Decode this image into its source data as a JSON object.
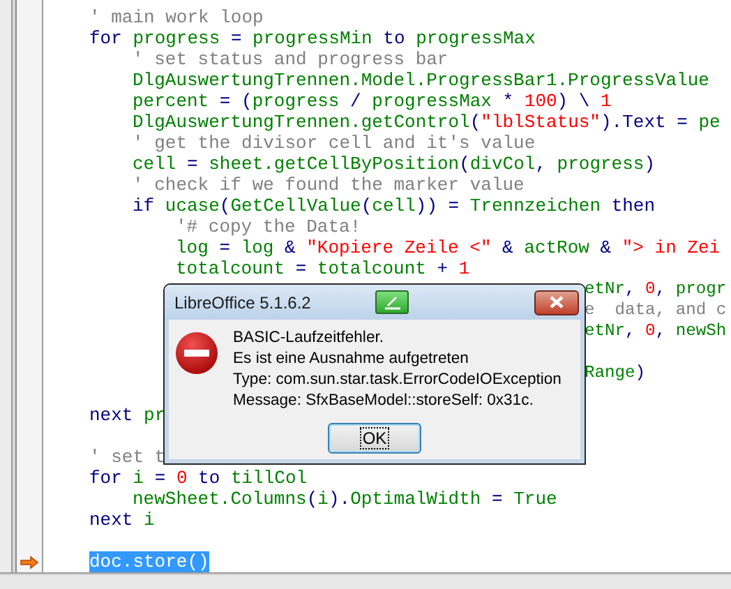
{
  "editor": {
    "lines": [
      {
        "kind": "code",
        "current": false,
        "selected": false,
        "code": [
          {
            "kind": "cm",
            "text": "' main work loop"
          }
        ]
      },
      {
        "kind": "code",
        "current": false,
        "selected": false,
        "code": [
          {
            "kind": "kw",
            "text": "for "
          },
          {
            "kind": "id",
            "text": "progress"
          },
          {
            "kind": "op",
            "text": " = "
          },
          {
            "kind": "id",
            "text": "progressMin"
          },
          {
            "kind": "kw",
            "text": " to "
          },
          {
            "kind": "id",
            "text": "progressMax"
          }
        ],
        "children": [
          {
            "kind": "code",
            "current": false,
            "selected": false,
            "code": [
              {
                "kind": "cm",
                "text": "' set status and progress bar"
              }
            ]
          },
          {
            "kind": "code",
            "current": false,
            "selected": false,
            "code": [
              {
                "kind": "id",
                "text": "DlgAuswertungTrennen.Model.ProgressBar1.ProgressValue"
              }
            ]
          },
          {
            "kind": "code",
            "current": false,
            "selected": false,
            "code": [
              {
                "kind": "id",
                "text": "percent"
              },
              {
                "kind": "op",
                "text": " = ("
              },
              {
                "kind": "id",
                "text": "progress"
              },
              {
                "kind": "op",
                "text": " / "
              },
              {
                "kind": "id",
                "text": "progressMax"
              },
              {
                "kind": "op",
                "text": " * "
              },
              {
                "kind": "nm",
                "text": "100"
              },
              {
                "kind": "op",
                "text": ") \\ "
              },
              {
                "kind": "nm",
                "text": "1"
              }
            ]
          },
          {
            "kind": "code",
            "current": false,
            "selected": false,
            "code": [
              {
                "kind": "id",
                "text": "DlgAuswertungTrennen.getControl"
              },
              {
                "kind": "op",
                "text": "("
              },
              {
                "kind": "st",
                "text": "\"lblStatus\""
              },
              {
                "kind": "op",
                "text": ")."
              },
              {
                "kind": "kw",
                "text": "Text"
              },
              {
                "kind": "op",
                "text": " = "
              },
              {
                "kind": "id",
                "text": "pe"
              }
            ]
          },
          {
            "kind": "code",
            "current": false,
            "selected": false,
            "code": [
              {
                "kind": "cm",
                "text": "' get the divisor cell and it's value"
              }
            ]
          },
          {
            "kind": "code",
            "current": false,
            "selected": false,
            "code": [
              {
                "kind": "id",
                "text": "cell"
              },
              {
                "kind": "op",
                "text": " = "
              },
              {
                "kind": "id",
                "text": "sheet.getCellByPosition"
              },
              {
                "kind": "op",
                "text": "("
              },
              {
                "kind": "id",
                "text": "divCol"
              },
              {
                "kind": "op",
                "text": ", "
              },
              {
                "kind": "id",
                "text": "progress"
              },
              {
                "kind": "op",
                "text": ")"
              }
            ]
          },
          {
            "kind": "code",
            "current": false,
            "selected": false,
            "code": [
              {
                "kind": "cm",
                "text": "' check if we found the marker value"
              }
            ]
          },
          {
            "kind": "code",
            "current": false,
            "selected": false,
            "code": [
              {
                "kind": "kw",
                "text": "if "
              },
              {
                "kind": "id",
                "text": "ucase"
              },
              {
                "kind": "op",
                "text": "("
              },
              {
                "kind": "id",
                "text": "GetCellValue"
              },
              {
                "kind": "op",
                "text": "("
              },
              {
                "kind": "id",
                "text": "cell"
              },
              {
                "kind": "op",
                "text": ")) = "
              },
              {
                "kind": "id",
                "text": "Trennzeichen"
              },
              {
                "kind": "kw",
                "text": " then"
              }
            ],
            "children": [
              {
                "kind": "code",
                "current": false,
                "selected": false,
                "code": [
                  {
                    "kind": "cm",
                    "text": "'# copy the Data!"
                  }
                ]
              },
              {
                "kind": "code",
                "current": false,
                "selected": false,
                "code": [
                  {
                    "kind": "id",
                    "text": "log"
                  },
                  {
                    "kind": "op",
                    "text": " = "
                  },
                  {
                    "kind": "id",
                    "text": "log"
                  },
                  {
                    "kind": "op",
                    "text": " & "
                  },
                  {
                    "kind": "st",
                    "text": "\"Kopiere Zeile <\""
                  },
                  {
                    "kind": "op",
                    "text": " & "
                  },
                  {
                    "kind": "id",
                    "text": "actRow"
                  },
                  {
                    "kind": "op",
                    "text": " & "
                  },
                  {
                    "kind": "st",
                    "text": "\"> in Zei"
                  }
                ]
              },
              {
                "kind": "code",
                "current": false,
                "selected": false,
                "code": [
                  {
                    "kind": "id",
                    "text": "totalcount"
                  },
                  {
                    "kind": "op",
                    "text": " = "
                  },
                  {
                    "kind": "id",
                    "text": "totalcount"
                  },
                  {
                    "kind": "op",
                    "text": " + "
                  },
                  {
                    "kind": "nm",
                    "text": "1"
                  }
                ]
              },
              {
                "kind": "covered",
                "current": false,
                "selected": false,
                "after": [
                  {
                    "kind": "id",
                    "text": "etNr"
                  },
                  {
                    "kind": "op",
                    "text": ", "
                  },
                  {
                    "kind": "nm",
                    "text": "0"
                  },
                  {
                    "kind": "op",
                    "text": ", "
                  },
                  {
                    "kind": "id",
                    "text": "progr"
                  }
                ]
              },
              {
                "kind": "covered",
                "current": false,
                "selected": false,
                "after": [
                  {
                    "kind": "cm",
                    "text": "e  data, and c"
                  }
                ]
              },
              {
                "kind": "covered",
                "current": false,
                "selected": false,
                "after": [
                  {
                    "kind": "id",
                    "text": "etNr"
                  },
                  {
                    "kind": "op",
                    "text": ", "
                  },
                  {
                    "kind": "nm",
                    "text": "0"
                  },
                  {
                    "kind": "op",
                    "text": ", "
                  },
                  {
                    "kind": "id",
                    "text": "newSh"
                  }
                ]
              },
              {
                "kind": "blank",
                "current": false,
                "selected": false
              },
              {
                "kind": "covered",
                "current": false,
                "selected": false,
                "after": [
                  {
                    "kind": "id",
                    "text": "Range"
                  },
                  {
                    "kind": "op",
                    "text": ")"
                  }
                ]
              }
            ]
          }
        ]
      },
      {
        "kind": "blank",
        "current": false,
        "selected": false
      },
      {
        "kind": "code",
        "current": false,
        "selected": false,
        "code": [
          {
            "kind": "kw",
            "text": "next "
          },
          {
            "kind": "id",
            "text": "pr"
          }
        ]
      },
      {
        "kind": "blank",
        "current": false,
        "selected": false
      },
      {
        "kind": "code",
        "current": false,
        "selected": false,
        "code": [
          {
            "kind": "cm",
            "text": "' set t"
          }
        ]
      },
      {
        "kind": "code",
        "current": false,
        "selected": false,
        "code": [
          {
            "kind": "kw",
            "text": "for "
          },
          {
            "kind": "id",
            "text": "i"
          },
          {
            "kind": "op",
            "text": " = "
          },
          {
            "kind": "nm",
            "text": "0"
          },
          {
            "kind": "kw",
            "text": " to "
          },
          {
            "kind": "id",
            "text": "tillCol"
          }
        ],
        "children": [
          {
            "kind": "code",
            "current": false,
            "selected": false,
            "code": [
              {
                "kind": "id",
                "text": "newSheet.Columns"
              },
              {
                "kind": "op",
                "text": "("
              },
              {
                "kind": "id",
                "text": "i"
              },
              {
                "kind": "op",
                "text": ")."
              },
              {
                "kind": "id",
                "text": "OptimalWidth"
              },
              {
                "kind": "op",
                "text": " = "
              },
              {
                "kind": "id",
                "text": "True"
              }
            ]
          }
        ]
      },
      {
        "kind": "code",
        "current": false,
        "selected": false,
        "code": [
          {
            "kind": "kw",
            "text": "next "
          },
          {
            "kind": "id",
            "text": "i"
          }
        ]
      },
      {
        "kind": "blank",
        "current": false,
        "selected": false
      },
      {
        "kind": "code",
        "current": true,
        "selected": true,
        "code": [
          {
            "kind": "id",
            "text": "doc.store()"
          }
        ]
      }
    ]
  },
  "dialog": {
    "title": "LibreOffice 5.1.6.2",
    "message_lines": [
      "BASIC-Laufzeitfehler.",
      "Es ist eine Ausnahme aufgetreten",
      "Type: com.sun.star.task.ErrorCodeIOException",
      "Message: SfxBaseModel::storeSelf: 0x31c."
    ],
    "buttons": [
      {
        "label": "OK",
        "focused": true
      }
    ]
  }
}
